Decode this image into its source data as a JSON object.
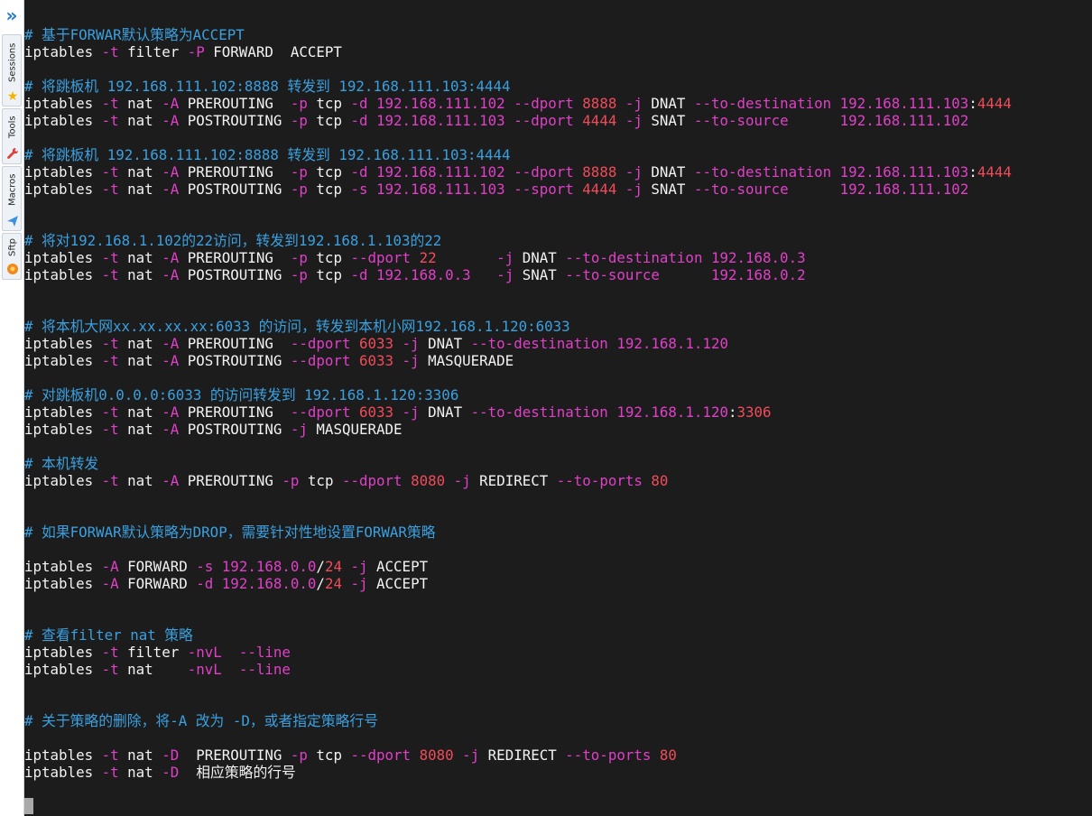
{
  "colors": {
    "background": "#1c1c1c",
    "text": "#f2f2f2",
    "comment": "#3aa0e0",
    "option": "#e040c8",
    "number": "#f04c5a",
    "cursor": "#a9a9a9"
  },
  "sidebar": {
    "tabs": [
      {
        "label": "Sessions",
        "icon": "star-icon"
      },
      {
        "label": "Tools",
        "icon": "wrench-icon"
      },
      {
        "label": "Macros",
        "icon": "send-icon"
      },
      {
        "label": "Sftp",
        "icon": "sftp-icon"
      }
    ]
  },
  "terminal": {
    "lines": [
      {
        "row": 1,
        "parts": [
          {
            "t": "# 基于FORWAR默认策略为ACCEPT",
            "c": "comment"
          }
        ]
      },
      {
        "row": 2,
        "parts": [
          {
            "t": "iptables "
          },
          {
            "t": "-t",
            "c": "option"
          },
          {
            "t": " filter "
          },
          {
            "t": "-P",
            "c": "option"
          },
          {
            "t": " FORWARD  ACCEPT"
          }
        ]
      },
      {
        "row": 4,
        "parts": [
          {
            "t": "# 将跳板机 192.168.111.102:8888 转发到 192.168.111.103:4444",
            "c": "comment"
          }
        ]
      },
      {
        "row": 5,
        "parts": [
          {
            "t": "iptables "
          },
          {
            "t": "-t",
            "c": "option"
          },
          {
            "t": " nat "
          },
          {
            "t": "-A",
            "c": "option"
          },
          {
            "t": " PREROUTING  "
          },
          {
            "t": "-p",
            "c": "option"
          },
          {
            "t": " tcp "
          },
          {
            "t": "-d",
            "c": "option"
          },
          {
            "t": " "
          },
          {
            "t": "192.168.111.102",
            "c": "option"
          },
          {
            "t": " "
          },
          {
            "t": "--dport",
            "c": "option"
          },
          {
            "t": " "
          },
          {
            "t": "8888",
            "c": "number"
          },
          {
            "t": " "
          },
          {
            "t": "-j",
            "c": "option"
          },
          {
            "t": " DNAT "
          },
          {
            "t": "--to-destination",
            "c": "option"
          },
          {
            "t": " "
          },
          {
            "t": "192.168.111.103",
            "c": "option"
          },
          {
            "t": ":"
          },
          {
            "t": "4444",
            "c": "number"
          }
        ]
      },
      {
        "row": 6,
        "parts": [
          {
            "t": "iptables "
          },
          {
            "t": "-t",
            "c": "option"
          },
          {
            "t": " nat "
          },
          {
            "t": "-A",
            "c": "option"
          },
          {
            "t": " POSTROUTING "
          },
          {
            "t": "-p",
            "c": "option"
          },
          {
            "t": " tcp "
          },
          {
            "t": "-d",
            "c": "option"
          },
          {
            "t": " "
          },
          {
            "t": "192.168.111.103",
            "c": "option"
          },
          {
            "t": " "
          },
          {
            "t": "--dport",
            "c": "option"
          },
          {
            "t": " "
          },
          {
            "t": "4444",
            "c": "number"
          },
          {
            "t": " "
          },
          {
            "t": "-j",
            "c": "option"
          },
          {
            "t": " SNAT "
          },
          {
            "t": "--to-source",
            "c": "option"
          },
          {
            "t": "      "
          },
          {
            "t": "192.168.111.102",
            "c": "option"
          }
        ]
      },
      {
        "row": 8,
        "parts": [
          {
            "t": "# 将跳板机 192.168.111.102:8888 转发到 192.168.111.103:4444",
            "c": "comment"
          }
        ]
      },
      {
        "row": 9,
        "parts": [
          {
            "t": "iptables "
          },
          {
            "t": "-t",
            "c": "option"
          },
          {
            "t": " nat "
          },
          {
            "t": "-A",
            "c": "option"
          },
          {
            "t": " PREROUTING  "
          },
          {
            "t": "-p",
            "c": "option"
          },
          {
            "t": " tcp "
          },
          {
            "t": "-d",
            "c": "option"
          },
          {
            "t": " "
          },
          {
            "t": "192.168.111.102",
            "c": "option"
          },
          {
            "t": " "
          },
          {
            "t": "--dport",
            "c": "option"
          },
          {
            "t": " "
          },
          {
            "t": "8888",
            "c": "number"
          },
          {
            "t": " "
          },
          {
            "t": "-j",
            "c": "option"
          },
          {
            "t": " DNAT "
          },
          {
            "t": "--to-destination",
            "c": "option"
          },
          {
            "t": " "
          },
          {
            "t": "192.168.111.103",
            "c": "option"
          },
          {
            "t": ":"
          },
          {
            "t": "4444",
            "c": "number"
          }
        ]
      },
      {
        "row": 10,
        "parts": [
          {
            "t": "iptables "
          },
          {
            "t": "-t",
            "c": "option"
          },
          {
            "t": " nat "
          },
          {
            "t": "-A",
            "c": "option"
          },
          {
            "t": " POSTROUTING "
          },
          {
            "t": "-p",
            "c": "option"
          },
          {
            "t": " tcp "
          },
          {
            "t": "-s",
            "c": "option"
          },
          {
            "t": " "
          },
          {
            "t": "192.168.111.103",
            "c": "option"
          },
          {
            "t": " "
          },
          {
            "t": "--sport",
            "c": "option"
          },
          {
            "t": " "
          },
          {
            "t": "4444",
            "c": "number"
          },
          {
            "t": " "
          },
          {
            "t": "-j",
            "c": "option"
          },
          {
            "t": " SNAT "
          },
          {
            "t": "--to-source",
            "c": "option"
          },
          {
            "t": "      "
          },
          {
            "t": "192.168.111.102",
            "c": "option"
          }
        ]
      },
      {
        "row": 13,
        "parts": [
          {
            "t": "# 将对192.168.1.102的22访问，转发到192.168.1.103的22",
            "c": "comment"
          }
        ]
      },
      {
        "row": 14,
        "parts": [
          {
            "t": "iptables "
          },
          {
            "t": "-t",
            "c": "option"
          },
          {
            "t": " nat "
          },
          {
            "t": "-A",
            "c": "option"
          },
          {
            "t": " PREROUTING  "
          },
          {
            "t": "-p",
            "c": "option"
          },
          {
            "t": " tcp "
          },
          {
            "t": "--dport",
            "c": "option"
          },
          {
            "t": " "
          },
          {
            "t": "22",
            "c": "number"
          },
          {
            "t": "       "
          },
          {
            "t": "-j",
            "c": "option"
          },
          {
            "t": " DNAT "
          },
          {
            "t": "--to-destination",
            "c": "option"
          },
          {
            "t": " "
          },
          {
            "t": "192.168.0.3",
            "c": "option"
          }
        ]
      },
      {
        "row": 15,
        "parts": [
          {
            "t": "iptables "
          },
          {
            "t": "-t",
            "c": "option"
          },
          {
            "t": " nat "
          },
          {
            "t": "-A",
            "c": "option"
          },
          {
            "t": " POSTROUTING "
          },
          {
            "t": "-p",
            "c": "option"
          },
          {
            "t": " tcp "
          },
          {
            "t": "-d",
            "c": "option"
          },
          {
            "t": " "
          },
          {
            "t": "192.168.0.3",
            "c": "option"
          },
          {
            "t": "   "
          },
          {
            "t": "-j",
            "c": "option"
          },
          {
            "t": " SNAT "
          },
          {
            "t": "--to-source",
            "c": "option"
          },
          {
            "t": "      "
          },
          {
            "t": "192.168.0.2",
            "c": "option"
          }
        ]
      },
      {
        "row": 18,
        "parts": [
          {
            "t": "# 将本机大网xx.xx.xx.xx:6033 的访问，转发到本机小网192.168.1.120:6033",
            "c": "comment"
          }
        ]
      },
      {
        "row": 19,
        "parts": [
          {
            "t": "iptables "
          },
          {
            "t": "-t",
            "c": "option"
          },
          {
            "t": " nat "
          },
          {
            "t": "-A",
            "c": "option"
          },
          {
            "t": " PREROUTING  "
          },
          {
            "t": "--dport",
            "c": "option"
          },
          {
            "t": " "
          },
          {
            "t": "6033",
            "c": "number"
          },
          {
            "t": " "
          },
          {
            "t": "-j",
            "c": "option"
          },
          {
            "t": " DNAT "
          },
          {
            "t": "--to-destination",
            "c": "option"
          },
          {
            "t": " "
          },
          {
            "t": "192.168.1.120",
            "c": "option"
          }
        ]
      },
      {
        "row": 20,
        "parts": [
          {
            "t": "iptables "
          },
          {
            "t": "-t",
            "c": "option"
          },
          {
            "t": " nat "
          },
          {
            "t": "-A",
            "c": "option"
          },
          {
            "t": " POSTROUTING "
          },
          {
            "t": "--dport",
            "c": "option"
          },
          {
            "t": " "
          },
          {
            "t": "6033",
            "c": "number"
          },
          {
            "t": " "
          },
          {
            "t": "-j",
            "c": "option"
          },
          {
            "t": " MASQUERADE"
          }
        ]
      },
      {
        "row": 22,
        "parts": [
          {
            "t": "# 对跳板机0.0.0.0:6033 的访问转发到 192.168.1.120:3306",
            "c": "comment"
          }
        ]
      },
      {
        "row": 23,
        "parts": [
          {
            "t": "iptables "
          },
          {
            "t": "-t",
            "c": "option"
          },
          {
            "t": " nat "
          },
          {
            "t": "-A",
            "c": "option"
          },
          {
            "t": " PREROUTING  "
          },
          {
            "t": "--dport",
            "c": "option"
          },
          {
            "t": " "
          },
          {
            "t": "6033",
            "c": "number"
          },
          {
            "t": " "
          },
          {
            "t": "-j",
            "c": "option"
          },
          {
            "t": " DNAT "
          },
          {
            "t": "--to-destination",
            "c": "option"
          },
          {
            "t": " "
          },
          {
            "t": "192.168.1.120",
            "c": "option"
          },
          {
            "t": ":"
          },
          {
            "t": "3306",
            "c": "number"
          }
        ]
      },
      {
        "row": 24,
        "parts": [
          {
            "t": "iptables "
          },
          {
            "t": "-t",
            "c": "option"
          },
          {
            "t": " nat "
          },
          {
            "t": "-A",
            "c": "option"
          },
          {
            "t": " POSTROUTING "
          },
          {
            "t": "-j",
            "c": "option"
          },
          {
            "t": " MASQUERADE"
          }
        ]
      },
      {
        "row": 26,
        "parts": [
          {
            "t": "# 本机转发",
            "c": "comment"
          }
        ]
      },
      {
        "row": 27,
        "parts": [
          {
            "t": "iptables "
          },
          {
            "t": "-t",
            "c": "option"
          },
          {
            "t": " nat "
          },
          {
            "t": "-A",
            "c": "option"
          },
          {
            "t": " PREROUTING "
          },
          {
            "t": "-p",
            "c": "option"
          },
          {
            "t": " tcp "
          },
          {
            "t": "--dport",
            "c": "option"
          },
          {
            "t": " "
          },
          {
            "t": "8080",
            "c": "number"
          },
          {
            "t": " "
          },
          {
            "t": "-j",
            "c": "option"
          },
          {
            "t": " REDIRECT "
          },
          {
            "t": "--to-ports",
            "c": "option"
          },
          {
            "t": " "
          },
          {
            "t": "80",
            "c": "number"
          }
        ]
      },
      {
        "row": 30,
        "parts": [
          {
            "t": "# 如果FORWAR默认策略为DROP，需要针对性地设置FORWAR策略",
            "c": "comment"
          }
        ]
      },
      {
        "row": 32,
        "parts": [
          {
            "t": "iptables "
          },
          {
            "t": "-A",
            "c": "option"
          },
          {
            "t": " FORWARD "
          },
          {
            "t": "-s",
            "c": "option"
          },
          {
            "t": " "
          },
          {
            "t": "192.168.0.0",
            "c": "option"
          },
          {
            "t": "/"
          },
          {
            "t": "24",
            "c": "number"
          },
          {
            "t": " "
          },
          {
            "t": "-j",
            "c": "option"
          },
          {
            "t": " ACCEPT"
          }
        ]
      },
      {
        "row": 33,
        "parts": [
          {
            "t": "iptables "
          },
          {
            "t": "-A",
            "c": "option"
          },
          {
            "t": " FORWARD "
          },
          {
            "t": "-d",
            "c": "option"
          },
          {
            "t": " "
          },
          {
            "t": "192.168.0.0",
            "c": "option"
          },
          {
            "t": "/"
          },
          {
            "t": "24",
            "c": "number"
          },
          {
            "t": " "
          },
          {
            "t": "-j",
            "c": "option"
          },
          {
            "t": " ACCEPT"
          }
        ]
      },
      {
        "row": 36,
        "parts": [
          {
            "t": "# 查看filter nat 策略",
            "c": "comment"
          }
        ]
      },
      {
        "row": 37,
        "parts": [
          {
            "t": "iptables "
          },
          {
            "t": "-t",
            "c": "option"
          },
          {
            "t": " filter "
          },
          {
            "t": "-nvL",
            "c": "option"
          },
          {
            "t": "  "
          },
          {
            "t": "--line",
            "c": "option"
          }
        ]
      },
      {
        "row": 38,
        "parts": [
          {
            "t": "iptables "
          },
          {
            "t": "-t",
            "c": "option"
          },
          {
            "t": " nat    "
          },
          {
            "t": "-nvL",
            "c": "option"
          },
          {
            "t": "  "
          },
          {
            "t": "--line",
            "c": "option"
          }
        ]
      },
      {
        "row": 41,
        "parts": [
          {
            "t": "# 关于策略的删除，将-A 改为 -D，或者指定策略行号",
            "c": "comment"
          }
        ]
      },
      {
        "row": 43,
        "parts": [
          {
            "t": "iptables "
          },
          {
            "t": "-t",
            "c": "option"
          },
          {
            "t": " nat "
          },
          {
            "t": "-D",
            "c": "option"
          },
          {
            "t": "  PREROUTING "
          },
          {
            "t": "-p",
            "c": "option"
          },
          {
            "t": " tcp "
          },
          {
            "t": "--dport",
            "c": "option"
          },
          {
            "t": " "
          },
          {
            "t": "8080",
            "c": "number"
          },
          {
            "t": " "
          },
          {
            "t": "-j",
            "c": "option"
          },
          {
            "t": " REDIRECT "
          },
          {
            "t": "--to-ports",
            "c": "option"
          },
          {
            "t": " "
          },
          {
            "t": "80",
            "c": "number"
          }
        ]
      },
      {
        "row": 44,
        "parts": [
          {
            "t": "iptables "
          },
          {
            "t": "-t",
            "c": "option"
          },
          {
            "t": " nat "
          },
          {
            "t": "-D",
            "c": "option"
          },
          {
            "t": "  相应策略的行号"
          }
        ]
      }
    ]
  }
}
